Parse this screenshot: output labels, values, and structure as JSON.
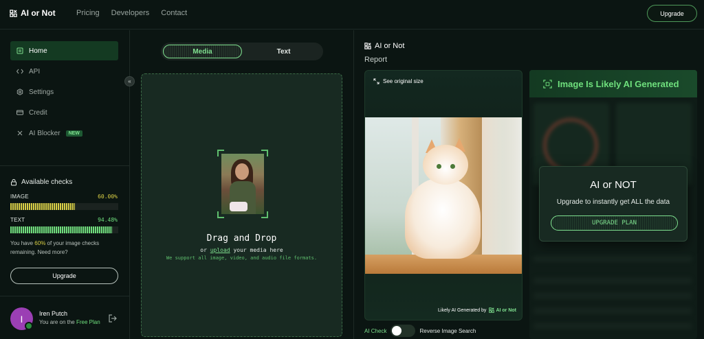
{
  "brand": {
    "name": "AI or Not"
  },
  "nav": {
    "items": [
      "Pricing",
      "Developers",
      "Contact"
    ],
    "upgrade_label": "Upgrade"
  },
  "sidebar": {
    "items": [
      {
        "label": "Home",
        "icon": "home-icon",
        "active": true
      },
      {
        "label": "API",
        "icon": "code-icon"
      },
      {
        "label": "Settings",
        "icon": "gear-icon"
      },
      {
        "label": "Credit",
        "icon": "card-icon"
      },
      {
        "label": "AI Blocker",
        "icon": "close-icon",
        "badge": "NEW"
      }
    ],
    "checks": {
      "title": "Available checks",
      "image": {
        "label": "IMAGE",
        "value": "60.00%",
        "fraction": 0.6,
        "color": "#d9cf45"
      },
      "text": {
        "label": "TEXT",
        "value": "94.48%",
        "fraction": 0.9448,
        "color": "#6fe07d"
      },
      "remaining_prefix": "You have ",
      "remaining_pct": "60%",
      "remaining_suffix": " of your image checks remaining. Need more?"
    },
    "upgrade_label": "Upgrade",
    "user": {
      "initial": "I",
      "name": "Iren Putch",
      "plan_prefix": "You are on the ",
      "plan": "Free Plan"
    }
  },
  "upload": {
    "tabs": [
      "Media",
      "Text"
    ],
    "active_tab": "Media",
    "title": "Drag and Drop",
    "sub_prefix": "or ",
    "sub_link": "upload",
    "sub_suffix": " your media here",
    "note": "We support all image, video, and audio file formats."
  },
  "report": {
    "brand": "AI or Not",
    "title": "Report",
    "see_original": "See original size",
    "likely_prefix": "Likely AI Generated by",
    "likely_brand": "AI or Not",
    "switch_left": "AI Check",
    "switch_right": "Reverse Image Search",
    "verdict": "Image Is Likely AI Generated",
    "upsell": {
      "title": "AI or NOT",
      "subtitle": "Upgrade to instantly get ALL the data",
      "button": "UPGRADE PLAN"
    }
  },
  "colors": {
    "accent": "#6fe07d",
    "bg": "#0b1512"
  }
}
